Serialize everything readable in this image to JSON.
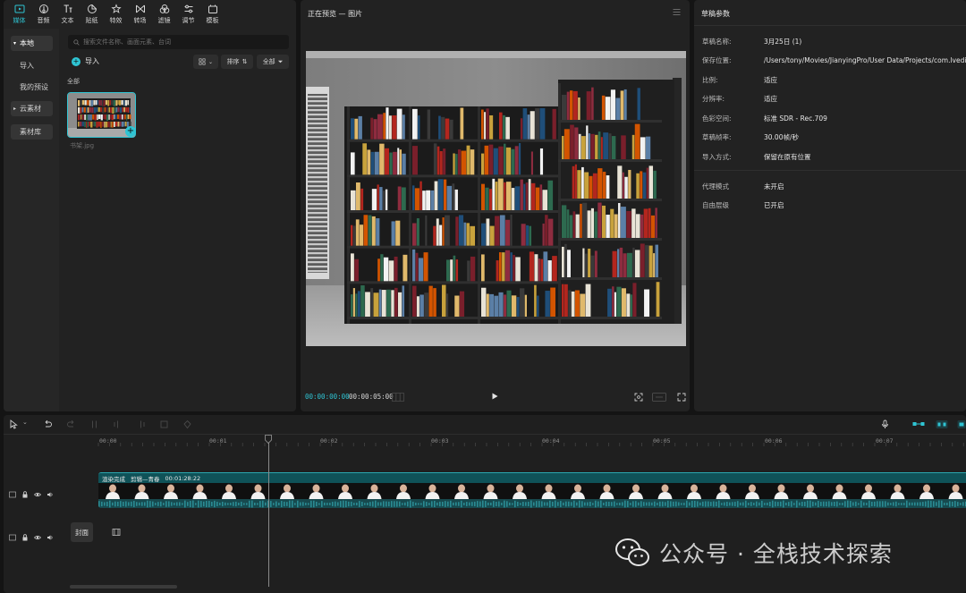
{
  "media": {
    "tools": [
      {
        "label": "媒体",
        "icon": "media-icon",
        "active": true
      },
      {
        "label": "音频",
        "icon": "audio-icon"
      },
      {
        "label": "文本",
        "icon": "text-icon"
      },
      {
        "label": "贴纸",
        "icon": "sticker-icon"
      },
      {
        "label": "特效",
        "icon": "effects-icon"
      },
      {
        "label": "转场",
        "icon": "transition-icon"
      },
      {
        "label": "滤镜",
        "icon": "filter-icon"
      },
      {
        "label": "调节",
        "icon": "adjust-icon"
      },
      {
        "label": "模板",
        "icon": "template-icon"
      }
    ],
    "nav": {
      "local": "本地",
      "import": "导入",
      "my_presets": "我的预设",
      "cloud": "云素材",
      "library": "素材库"
    },
    "search_placeholder": "搜索文件名称、画面元素、台词",
    "import_label": "导入",
    "sort_label": "排序",
    "filter_label": "全部",
    "section_label": "全部",
    "thumbnail_name": "书架.jpg"
  },
  "preview": {
    "title": "正在预览 — 图片",
    "current_time": "00:00:00:00",
    "total_time": "00:00:05:00"
  },
  "params": {
    "title": "草稿参数",
    "rows": [
      {
        "k": "草稿名称:",
        "v": "3月25日 (1)"
      },
      {
        "k": "保存位置:",
        "v": "/Users/tony/Movies/JianyingPro/User Data/Projects/com.lveditor.draft/3月25日 (1)"
      },
      {
        "k": "比例:",
        "v": "适应"
      },
      {
        "k": "分辨率:",
        "v": "适应"
      },
      {
        "k": "色彩空间:",
        "v": "标准 SDR - Rec.709"
      },
      {
        "k": "草稿帧率:",
        "v": "30.00帧/秒"
      },
      {
        "k": "导入方式:",
        "v": "保留在原有位置"
      }
    ],
    "rows2": [
      {
        "k": "代理模式",
        "v": "未开启"
      },
      {
        "k": "自由层级",
        "v": "已开启"
      }
    ]
  },
  "timeline": {
    "ticks": [
      "00:00",
      "00:01",
      "00:02",
      "00:03",
      "00:04",
      "00:05",
      "00:06",
      "00:07"
    ],
    "clip": {
      "status": "渲染完成",
      "name": "剪辑—青春",
      "duration": "00:01:28:22"
    },
    "cover_label": "封面"
  },
  "watermark": "公众号 · 全栈技术探索",
  "colors": {
    "accent": "#2fc4d3",
    "panel": "#222222",
    "clip": "#1b3f43"
  }
}
